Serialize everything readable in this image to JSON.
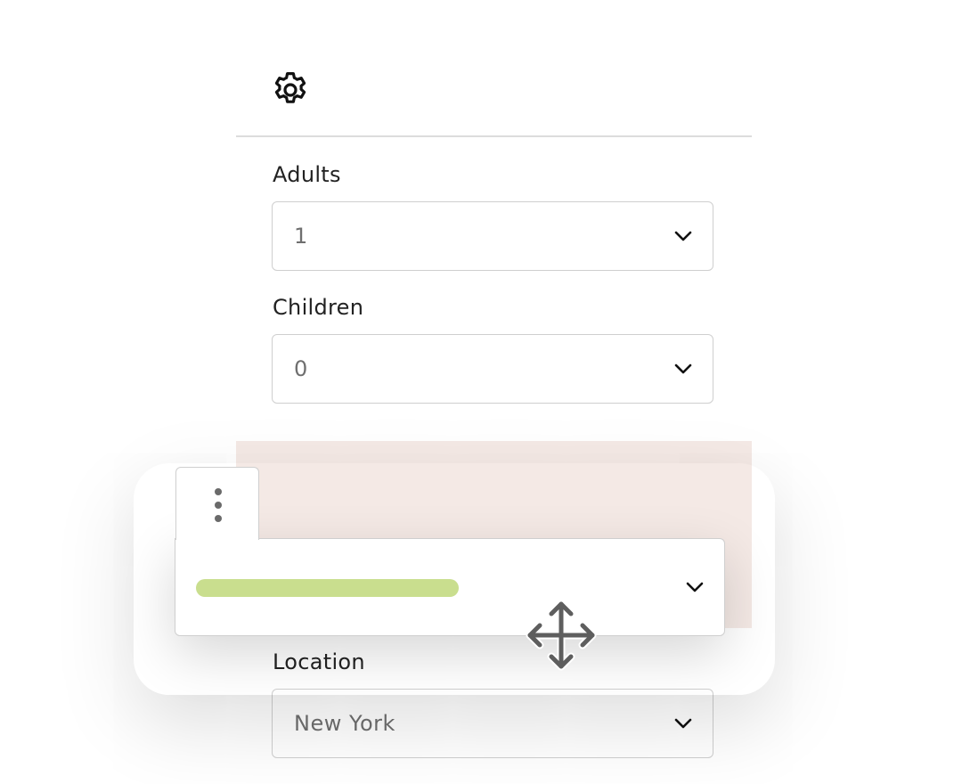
{
  "toolbar": {
    "settings_icon": "gear-icon"
  },
  "form": {
    "adults": {
      "label": "Adults",
      "value": "1"
    },
    "children": {
      "label": "Children",
      "value": "0"
    },
    "location": {
      "label": "Location",
      "value": "New York"
    }
  },
  "drag_preview": {
    "handle_icon": "vertical-dots-icon",
    "cursor_icon": "move-cursor-icon",
    "placeholder_color": "#c9de8e",
    "drop_zone_color": "#f4e9e5"
  }
}
